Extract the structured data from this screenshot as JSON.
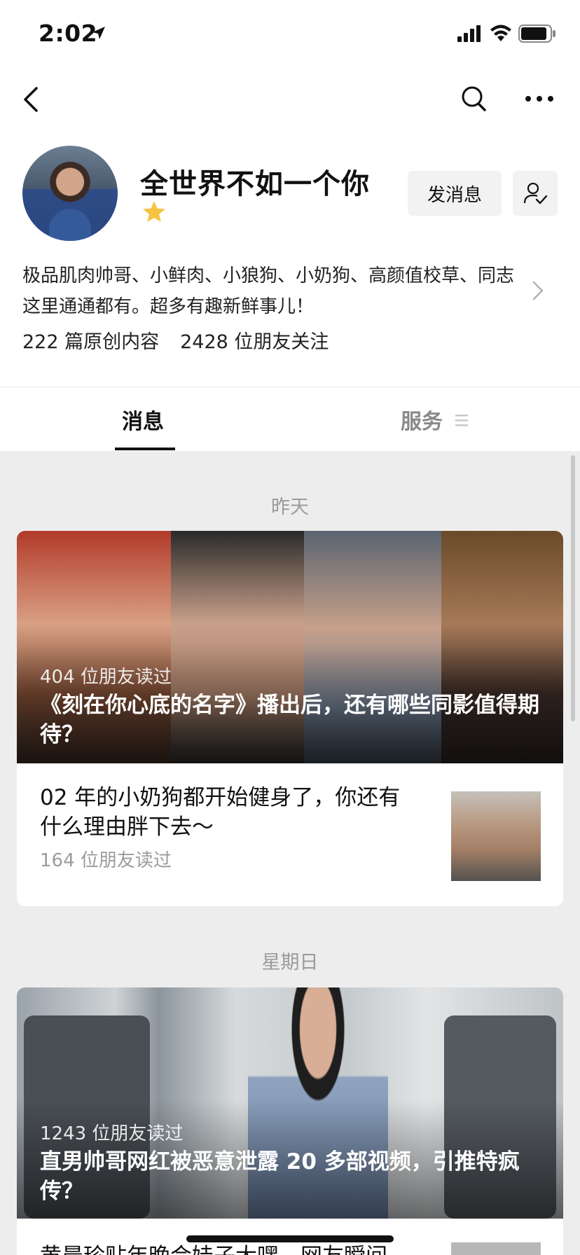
{
  "status_bar": {
    "time": "2:02",
    "icons": [
      "location-arrow-icon",
      "signal-icon",
      "wifi-icon",
      "battery-icon"
    ]
  },
  "nav": {
    "icons": [
      "back-icon",
      "search-icon",
      "more-icon"
    ]
  },
  "profile": {
    "name": "全世界不如一个你",
    "star_icon": "star-icon",
    "message_button": "发消息",
    "follow_icon": "user-check-icon",
    "bio": "极品肌肉帅哥、小鲜肉、小狼狗、小奶狗、高颜值校草、同志这里通通都有。超多有趣新鲜事儿！",
    "original_count": "222 篇原创内容",
    "followers": "2428 位朋友关注"
  },
  "tabs": {
    "messages": "消息",
    "services": "服务"
  },
  "feed": {
    "groups": [
      {
        "date": "昨天",
        "featured": {
          "reads": "404 位朋友读过",
          "title": "《刻在你心底的名字》播出后，还有哪些同影值得期待？"
        },
        "article": {
          "title": "02 年的小奶狗都开始健身了，你还有什么理由胖下去～",
          "reads": "164 位朋友读过"
        }
      },
      {
        "date": "星期日",
        "featured": {
          "reads": "1243 位朋友读过",
          "title": "直男帅哥网红被恶意泄露 20 多部视频，引推特疯传？"
        },
        "article": {
          "title": "黄晨珍贴年晚会娃子大嘿，网友瞬间"
        }
      }
    ]
  },
  "colors": {
    "background": "#ededed",
    "card": "#ffffff",
    "muted_text": "#9b9b9b",
    "star": "#f7c343"
  }
}
